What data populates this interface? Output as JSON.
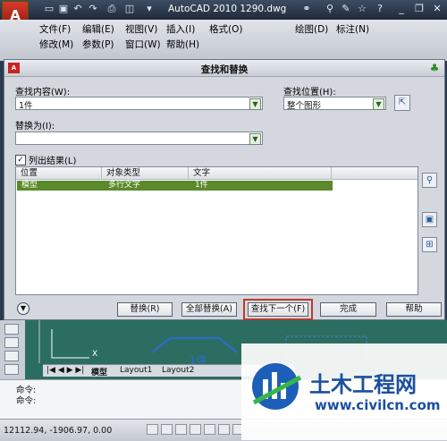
{
  "titlebar": {
    "app_logo": "A",
    "title": "AutoCAD 2010    1290.dwg"
  },
  "menubar": {
    "row1": [
      "文件(F)",
      "编辑(E)",
      "视图(V)",
      "插入(I)",
      "格式(O)",
      "绘图(D)",
      "标注(N)"
    ],
    "row2": [
      "修改(M)",
      "参数(P)",
      "窗口(W)",
      "帮助(H)"
    ]
  },
  "dialog": {
    "title": "查找和替换",
    "find_label": "查找内容(W):",
    "find_value": "1件",
    "search_in_label": "查找位置(H):",
    "search_in_value": "整个图形",
    "replace_label": "替换为(I):",
    "replace_value": "",
    "list_results_label": "列出结果(L)",
    "list_results_checked": true,
    "columns": [
      "位置",
      "对象类型",
      "文字"
    ],
    "rows": [
      {
        "location": "模型",
        "type": "多行文字",
        "text": "1件"
      }
    ],
    "buttons": {
      "replace": "替换(R)",
      "replace_all": "全部替换(A)",
      "find_next": "查找下一个(F)",
      "done": "完成",
      "help": "帮助"
    },
    "highlight_color": "#c0392b"
  },
  "drawing": {
    "tabs": [
      "模型",
      "Layout1",
      "Layout2"
    ],
    "axis_x": "X",
    "annotation": "1件"
  },
  "command": {
    "line1": "命令:",
    "line2": "命令:"
  },
  "status": {
    "coords": "12112.94,  -1906.97,  0.00"
  },
  "watermark": {
    "name": "土木工程网",
    "url": "www.civilcn.com"
  }
}
